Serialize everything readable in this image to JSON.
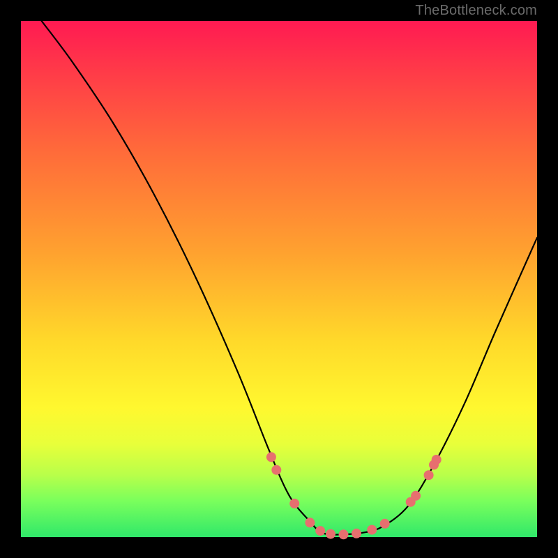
{
  "watermark": "TheBottleneck.com",
  "chart_data": {
    "type": "line",
    "title": "",
    "xlabel": "",
    "ylabel": "",
    "xlim": [
      0,
      100
    ],
    "ylim": [
      0,
      100
    ],
    "series": [
      {
        "name": "curve",
        "x": [
          4,
          10,
          18,
          26,
          34,
          42,
          48,
          52,
          56,
          58,
          60,
          62,
          66,
          70,
          75,
          80,
          86,
          92,
          100
        ],
        "y": [
          100,
          92,
          80,
          66,
          50,
          32,
          17,
          8,
          3,
          1,
          0.5,
          0.5,
          0.8,
          2,
          6,
          14,
          26,
          40,
          58
        ]
      }
    ],
    "markers": [
      {
        "x": 48.5,
        "y": 15.5
      },
      {
        "x": 49.5,
        "y": 13.0
      },
      {
        "x": 53.0,
        "y": 6.5
      },
      {
        "x": 56.0,
        "y": 2.8
      },
      {
        "x": 58.0,
        "y": 1.2
      },
      {
        "x": 60.0,
        "y": 0.6
      },
      {
        "x": 62.5,
        "y": 0.5
      },
      {
        "x": 65.0,
        "y": 0.7
      },
      {
        "x": 68.0,
        "y": 1.4
      },
      {
        "x": 70.5,
        "y": 2.6
      },
      {
        "x": 75.5,
        "y": 6.8
      },
      {
        "x": 76.5,
        "y": 8.0
      },
      {
        "x": 79.0,
        "y": 12.0
      },
      {
        "x": 80.0,
        "y": 14.0
      },
      {
        "x": 80.5,
        "y": 15.0
      }
    ],
    "colors": {
      "curve_stroke": "#000000",
      "marker_fill": "#e76f6f",
      "gradient_top": "#ff1a52",
      "gradient_bottom": "#30e86a"
    }
  }
}
